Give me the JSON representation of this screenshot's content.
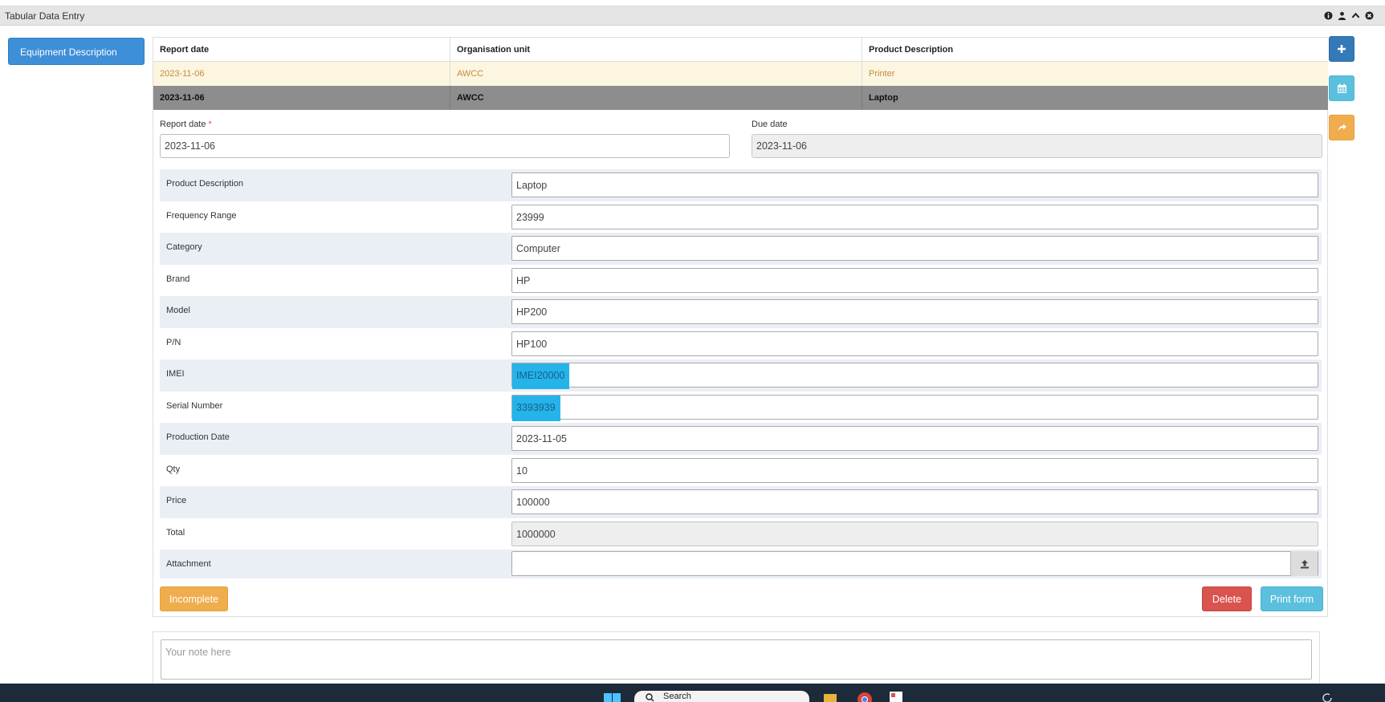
{
  "window": {
    "title": "Tabular Data Entry"
  },
  "sidebar": {
    "items": [
      {
        "label": "Equipment Description"
      }
    ]
  },
  "grid": {
    "columns": [
      "Report date",
      "Organisation unit",
      "Product Description"
    ],
    "rows": [
      {
        "report_date": "2023-11-06",
        "org_unit": "AWCC",
        "product": "Printer",
        "state": "alt"
      },
      {
        "report_date": "2023-11-06",
        "org_unit": "AWCC",
        "product": "Laptop",
        "state": "selected"
      }
    ]
  },
  "header_fields": {
    "report_date": {
      "label": "Report date",
      "required_mark": "*",
      "value": "2023-11-06"
    },
    "due_date": {
      "label": "Due date",
      "value": "2023-11-06"
    }
  },
  "fields": [
    {
      "label": "Product Description",
      "value": "Laptop"
    },
    {
      "label": "Frequency Range",
      "value": "23999"
    },
    {
      "label": "Category",
      "value": "Computer"
    },
    {
      "label": "Brand",
      "value": "HP"
    },
    {
      "label": "Model",
      "value": "HP200"
    },
    {
      "label": "P/N",
      "value": "HP100"
    },
    {
      "label": "IMEI",
      "value": "IMEI20000",
      "highlighted": true
    },
    {
      "label": "Serial Number",
      "value": "3393939",
      "highlighted": true
    },
    {
      "label": "Production Date",
      "value": "2023-11-05"
    },
    {
      "label": "Qty",
      "value": "10"
    },
    {
      "label": "Price",
      "value": "100000"
    },
    {
      "label": "Total",
      "value": "1000000",
      "readonly": true
    },
    {
      "label": "Attachment",
      "value": ""
    }
  ],
  "buttons": {
    "incomplete": "Incomplete",
    "delete": "Delete",
    "print": "Print form"
  },
  "note": {
    "placeholder": "Your note here"
  },
  "taskbar": {
    "search_label": "Search"
  },
  "colors": {
    "primary": "#337ab7",
    "info": "#5bc0de",
    "warning": "#f0ad4e",
    "danger": "#d9534f",
    "highlight": "#24b4ea"
  },
  "icons": [
    "info-icon",
    "user-icon",
    "chevron-up-icon",
    "close-icon",
    "plus-icon",
    "calendar-icon",
    "share-icon",
    "upload-icon"
  ]
}
